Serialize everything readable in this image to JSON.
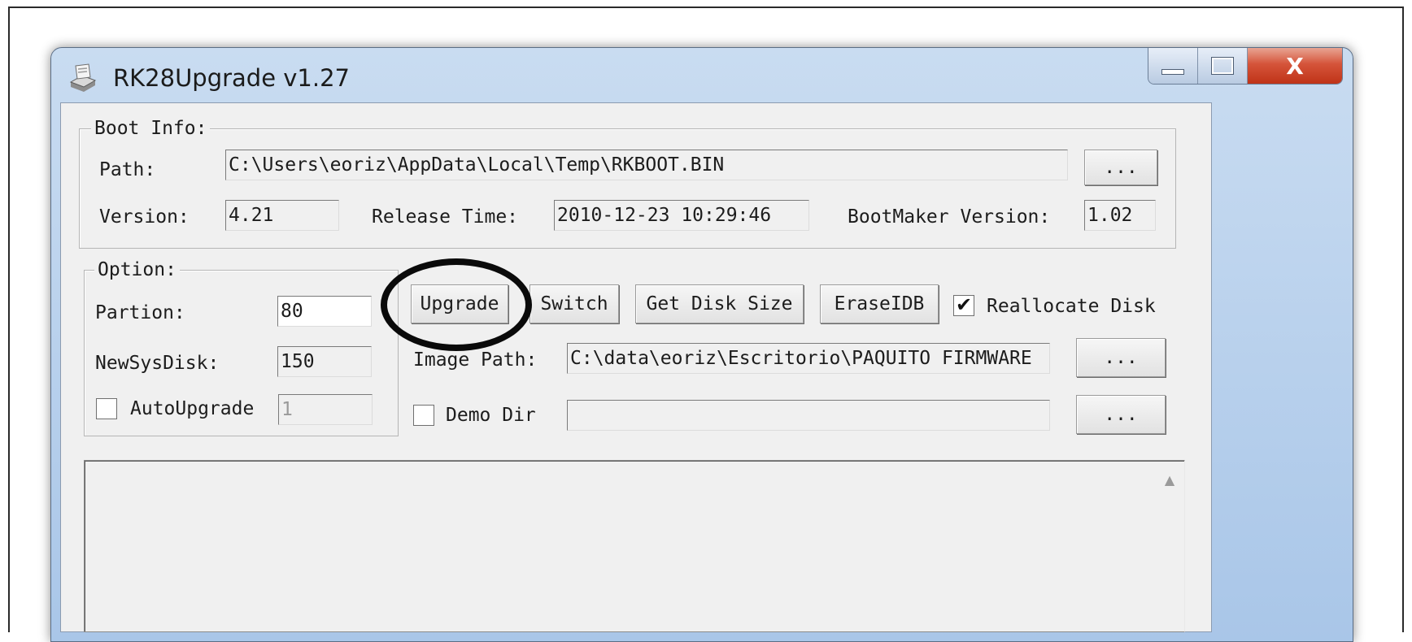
{
  "window": {
    "title": "RK28Upgrade v1.27",
    "close_glyph": "X"
  },
  "boot_info": {
    "group_label": "Boot Info:",
    "path_label": "Path:",
    "path_value": "C:\\Users\\eoriz\\AppData\\Local\\Temp\\RKBOOT.BIN",
    "browse_label": "...",
    "version_label": "Version:",
    "version_value": "4.21",
    "release_time_label": "Release Time:",
    "release_time_value": "2010-12-23 10:29:46",
    "bootmaker_label": "BootMaker Version:",
    "bootmaker_value": "1.02"
  },
  "option": {
    "group_label": "Option:",
    "partion_label": "Partion:",
    "partion_value": "80",
    "newsysdisk_label": "NewSysDisk:",
    "newsysdisk_value": "150",
    "autoupgrade_label": "AutoUpgrade",
    "autoupgrade_value": "1"
  },
  "actions": {
    "upgrade": "Upgrade",
    "switch": "Switch",
    "get_disk_size": "Get Disk Size",
    "erase_idb": "EraseIDB",
    "reallocate_label": "Reallocate Disk",
    "reallocate_checked": true
  },
  "image": {
    "path_label": "Image Path:",
    "path_value": "C:\\data\\eoriz\\Escritorio\\PAQUITO FIRMWARE",
    "browse_label": "...",
    "demo_dir_label": "Demo Dir",
    "demo_dir_value": "",
    "demo_browse_label": "..."
  },
  "icons": {
    "app": "installer-icon",
    "minimize": "minimize-icon",
    "maximize": "maximize-icon",
    "close": "close-icon",
    "check": "checkmark-icon",
    "scroll_up": "scroll-up-arrow-icon"
  },
  "colors": {
    "highlight_circle": "#0a0a0a",
    "close_button": "#d5543a"
  }
}
